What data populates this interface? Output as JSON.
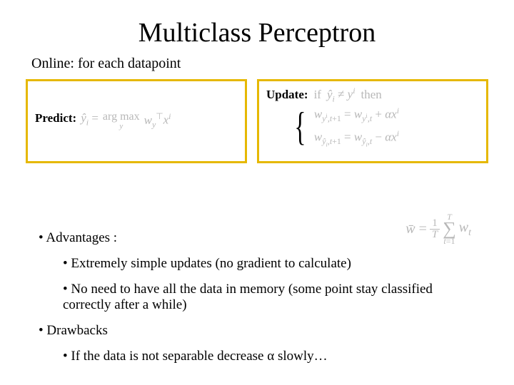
{
  "title": "Multiclass Perceptron",
  "online": "Online: for each datapoint",
  "predict": {
    "label": "Predict:",
    "lhs": "ŷᵢ =",
    "argmax_top": "arg max",
    "argmax_sub": "y",
    "rhs": "w_y^⊤ x^i"
  },
  "update": {
    "label": "Update:",
    "if": "if",
    "cond": "ŷᵢ ≠ yⁱ",
    "then": "then",
    "eq1_lhs": "w_{yⁱ,t+1}",
    "eq1_rhs": "= w_{yⁱ,t} + αxⁱ",
    "eq2_lhs": "w_{ŷᵢ,t+1}",
    "eq2_rhs": "= w_{ŷᵢ,t} − αxⁱ"
  },
  "wbar": {
    "lhs": "w̄ =",
    "frac_num": "1",
    "frac_den": "T",
    "sum_top": "T",
    "sum_sym": "∑",
    "sum_bot": "t=1",
    "term": "w_t"
  },
  "bullets": {
    "adv": "• Advantages :",
    "adv1": "• Extremely simple updates (no gradient to calculate)",
    "adv2": "• No need to have all the data in memory (some point stay classified correctly after a while)",
    "drw": "• Drawbacks",
    "drw1": "• If the data is not separable decrease α slowly…"
  }
}
